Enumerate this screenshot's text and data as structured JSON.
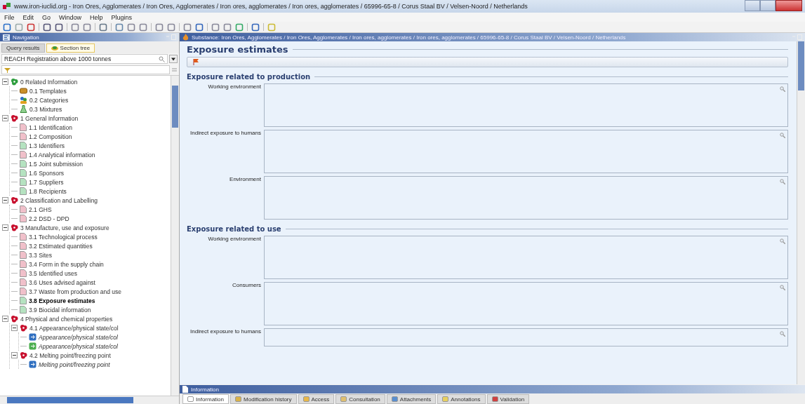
{
  "window": {
    "title": "www.iron-iuclid.org - Iron Ores, Agglomerates / Iron Ores, Agglomerates / Iron ores, agglomerates  / Iron ores, agglomerates  / 65996-65-8 / Corus Staal BV / Velsen-Noord / Netherlands"
  },
  "menu": [
    "File",
    "Edit",
    "Go",
    "Window",
    "Help",
    "Plugins"
  ],
  "navigation": {
    "title": "Navigation",
    "tabs": [
      {
        "label": "Query results",
        "selected": false
      },
      {
        "label": "Section tree",
        "selected": true
      }
    ],
    "template": "REACH Registration above 1000 tonnes",
    "tree": [
      {
        "label": "0 Related Information",
        "kind": "section",
        "color": "#2e9e3e",
        "expanded": true,
        "selected": false,
        "children": [
          {
            "label": "0.1 Templates",
            "kind": "template",
            "selected": false
          },
          {
            "label": "0.2 Categories",
            "kind": "category",
            "selected": false
          },
          {
            "label": "0.3 Mixtures",
            "kind": "mixture",
            "selected": false
          }
        ]
      },
      {
        "label": "1 General Information",
        "kind": "section",
        "color": "#c8102e",
        "expanded": true,
        "selected": false,
        "children": [
          {
            "label": "1.1 Identification",
            "kind": "page",
            "color": "#f0c0ca",
            "selected": false
          },
          {
            "label": "1.2 Composition",
            "kind": "page",
            "color": "#f0c0ca",
            "selected": false
          },
          {
            "label": "1.3 Identifiers",
            "kind": "page",
            "color": "#b5e2c0",
            "selected": false
          },
          {
            "label": "1.4 Analytical information",
            "kind": "page",
            "color": "#f0c0ca",
            "selected": false
          },
          {
            "label": "1.5 Joint submission",
            "kind": "page",
            "color": "#b5e2c0",
            "selected": false
          },
          {
            "label": "1.6 Sponsors",
            "kind": "page",
            "color": "#b5e2c0",
            "selected": false
          },
          {
            "label": "1.7 Suppliers",
            "kind": "page",
            "color": "#b5e2c0",
            "selected": false
          },
          {
            "label": "1.8 Recipients",
            "kind": "page",
            "color": "#b5e2c0",
            "selected": false
          }
        ]
      },
      {
        "label": "2 Classification and Labelling",
        "kind": "section",
        "color": "#c8102e",
        "expanded": true,
        "selected": false,
        "children": [
          {
            "label": "2.1 GHS",
            "kind": "page",
            "color": "#f0c0ca",
            "selected": false
          },
          {
            "label": "2.2 DSD - DPD",
            "kind": "page",
            "color": "#f0c0ca",
            "selected": false
          }
        ]
      },
      {
        "label": "3 Manufacture, use and exposure",
        "kind": "section",
        "color": "#c8102e",
        "expanded": true,
        "selected": false,
        "children": [
          {
            "label": "3.1 Technological process",
            "kind": "page",
            "color": "#f0c0ca",
            "selected": false
          },
          {
            "label": "3.2 Estimated quantities",
            "kind": "page",
            "color": "#f0c0ca",
            "selected": false
          },
          {
            "label": "3.3 Sites",
            "kind": "page",
            "color": "#f0c0ca",
            "selected": false
          },
          {
            "label": "3.4 Form in the supply chain",
            "kind": "page",
            "color": "#f0c0ca",
            "selected": false
          },
          {
            "label": "3.5 Identified uses",
            "kind": "page",
            "color": "#f0c0ca",
            "selected": false
          },
          {
            "label": "3.6 Uses advised against",
            "kind": "page",
            "color": "#f0c0ca",
            "selected": false
          },
          {
            "label": "3.7 Waste from production and use",
            "kind": "page",
            "color": "#f0c0ca",
            "selected": false
          },
          {
            "label": "3.8 Exposure estimates",
            "kind": "page",
            "color": "#b5e2c0",
            "selected": true
          },
          {
            "label": "3.9 Biocidal information",
            "kind": "page",
            "color": "#b5e2c0",
            "selected": false
          }
        ]
      },
      {
        "label": "4 Physical and chemical properties",
        "kind": "section",
        "color": "#c8102e",
        "expanded": true,
        "selected": false,
        "children": [
          {
            "label": "4.1 Appearance/physical state/col",
            "kind": "section",
            "color": "#c8102e",
            "expanded": true,
            "selected": false,
            "children": [
              {
                "label": "Appearance/physical state/col",
                "kind": "record",
                "color": "#2f6fc0",
                "selected": false
              },
              {
                "label": "Appearance/physical state/col",
                "kind": "record",
                "color": "#4caf50",
                "selected": false
              }
            ]
          },
          {
            "label": "4.2 Melting point/freezing point",
            "kind": "section",
            "color": "#c8102e",
            "expanded": true,
            "selected": false,
            "children": [
              {
                "label": "Melting point/freezing point",
                "kind": "record",
                "color": "#2f6fc0",
                "selected": false
              }
            ]
          }
        ]
      }
    ]
  },
  "editor": {
    "title": "Substance: Iron Ores, Agglomerates / Iron Ores, Agglomerates / Iron ores, agglomerates  / Iron ores, agglomerates  / 65996-65-8 / Corus Staal BV / Velsen-Noord / Netherlands",
    "heading": "Exposure estimates",
    "sections": [
      {
        "heading": "Exposure related to production",
        "fields": [
          {
            "label": "Working environment"
          },
          {
            "label": "Indirect exposure to humans"
          },
          {
            "label": "Environment"
          }
        ]
      },
      {
        "heading": "Exposure related to use",
        "fields": [
          {
            "label": "Working environment"
          },
          {
            "label": "Consumers"
          },
          {
            "label": "Indirect exposure to humans"
          }
        ]
      }
    ]
  },
  "info_panel": {
    "title": "Information",
    "tabs": [
      {
        "label": "Information",
        "selected": true
      },
      {
        "label": "Modification history",
        "selected": false
      },
      {
        "label": "Access",
        "selected": false
      },
      {
        "label": "Consultation",
        "selected": false
      },
      {
        "label": "Attachments",
        "selected": false
      },
      {
        "label": "Annotations",
        "selected": false
      },
      {
        "label": "Validation",
        "selected": false
      }
    ]
  }
}
